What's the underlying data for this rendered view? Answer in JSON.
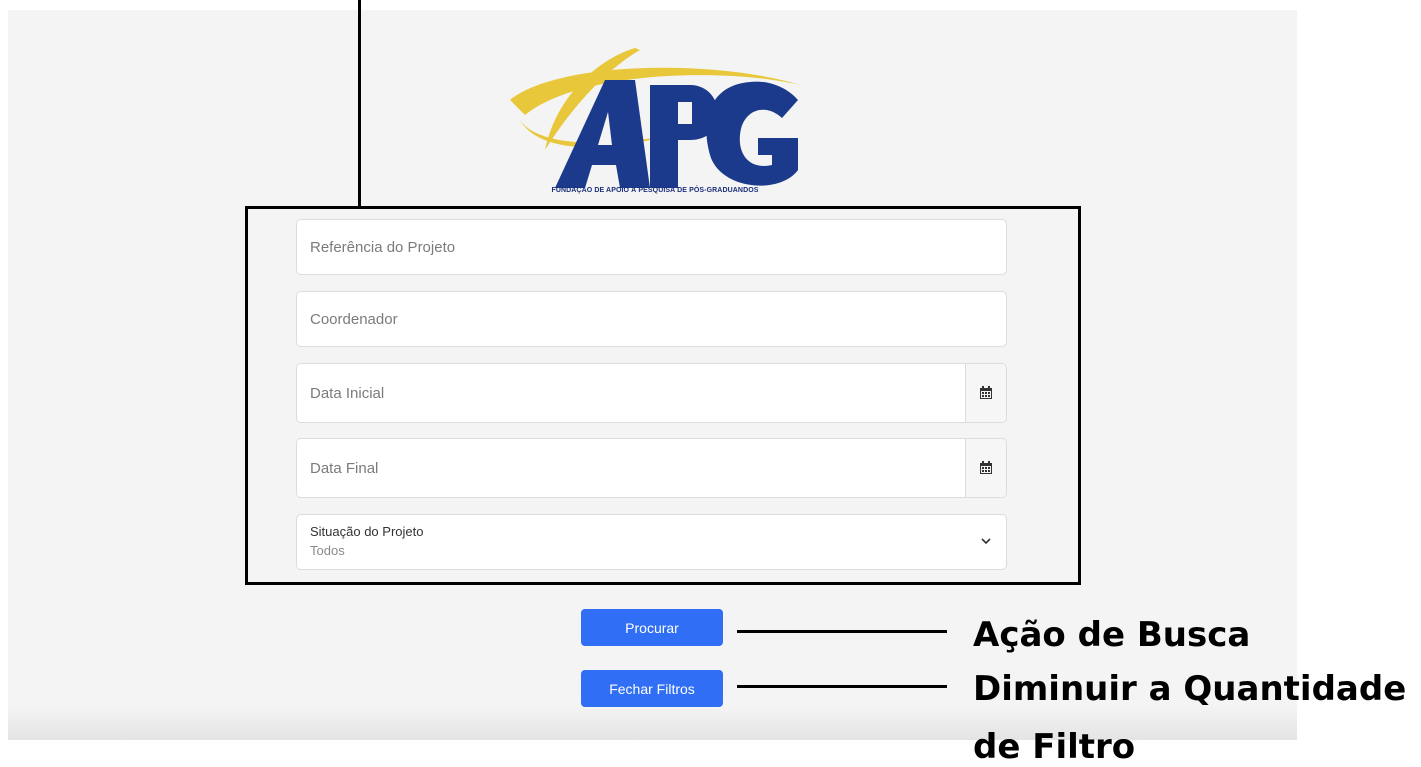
{
  "logo": {
    "letters": "APG",
    "caption": "FUNDAÇÃO DE APOIO À PESQUISA DE PÓS-GRADUANDOS",
    "colors": {
      "navy": "#1b3a8c",
      "gold": "#e8c83a"
    }
  },
  "form": {
    "reference_placeholder": "Referência do Projeto",
    "coordinator_placeholder": "Coordenador",
    "start_date_placeholder": "Data Inicial",
    "end_date_placeholder": "Data Final",
    "status_label": "Situação do Projeto",
    "status_value": "Todos",
    "calendar_icon": "calendar-icon",
    "chevron_icon": "chevron-down-icon"
  },
  "buttons": {
    "search_label": "Procurar",
    "close_filters_label": "Fechar Filtros",
    "color": "#2f6ef5"
  },
  "annotations": {
    "search_action": "Ação de Busca",
    "reduce_filters_line1": "Diminuir a Quantidade",
    "reduce_filters_line2": "de Filtro"
  }
}
